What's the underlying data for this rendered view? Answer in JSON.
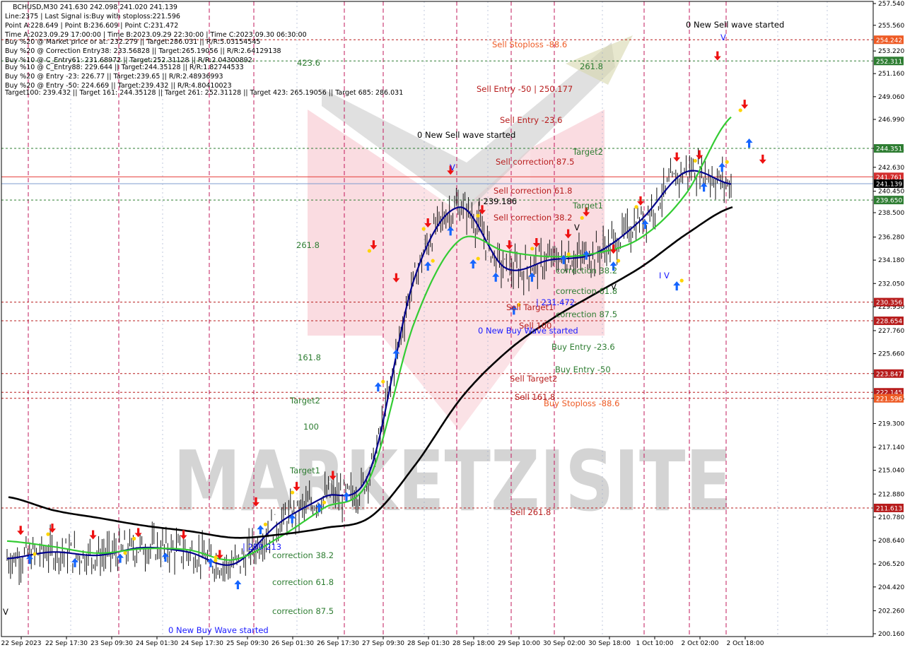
{
  "header": {
    "lines": [
      "BCHUSD,M30  241.630 242.098 241.020 241.139",
      "Line:2375  |  Last Signal is:Buy with stoploss:221.596",
      "Point A:228.649  |  Point B:236.609  |  Point C:231.472",
      "Time A:2023.09.29 17:00:00  |  Time B:2023.09.29 22:30:00  |  Time C:2023.09.30 06:30:00",
      "Buy %20 @ Market price or at: 232.279  ||  Target:286.031  ||  R/R:5.03154545",
      "Buy %20 @ Correction Entry38: 233.56828  ||  Target:265.19056  ||  R/R:2.64129138",
      "Buy %10 @ C_Entry61: 231.68972  ||  Target:252.31128  ||  R/R:2.04300892",
      "Buy %10 @ C_Entry88: 229.644  ||  Target:244.35128  ||  R/R:1.82744533",
      "Buy %20 @ Entry -23: 226.77  ||  Target:239.65  ||  R/R:2.48936993",
      "Buy %20 @ Entry -50: 224.669  ||  Target:239.432  ||  R/R:4.80410023",
      "Target100: 239.432  ||  Target 161: 244.35128  ||  Target 261: 252.31128  ||  Target 423: 265.19056  ||  Target 685: 286.031"
    ]
  },
  "colors": {
    "background": "#ffffff",
    "session_line": "#c2185b",
    "green_level": "#2e7d32",
    "red_level": "#b71c1c",
    "blue_line": "#00008b",
    "green_ma": "#33cc33",
    "black_ma": "#000000",
    "buy_arrow": "#1565ff",
    "sell_arrow": "#ee1111",
    "star": "#ffd400",
    "watermark": "#b8b8b8",
    "pink_arrow": "#f29ca8"
  },
  "watermark": {
    "text": "MARKETZISITE"
  },
  "price_axis": {
    "ticks": [
      "257.540",
      "255.560",
      "253.220",
      "251.160",
      "249.060",
      "246.990",
      "244.351",
      "242.630",
      "240.450",
      "238.500",
      "236.280",
      "234.180",
      "232.050",
      "229.930",
      "227.760",
      "225.660",
      "223.847",
      "221.596",
      "219.300",
      "217.140",
      "215.040",
      "212.880",
      "210.780",
      "208.640",
      "206.520",
      "204.420",
      "202.260",
      "200.160"
    ],
    "badges": [
      {
        "text": "254.242",
        "color": "#ee5a24"
      },
      {
        "text": "252.311",
        "color": "#2e7d32"
      },
      {
        "text": "244.351",
        "color": "#2e7d32"
      },
      {
        "text": "241.761",
        "color": "#d32f2f"
      },
      {
        "text": "241.139",
        "color": "#000000"
      },
      {
        "text": "239.650",
        "color": "#2e7d32"
      },
      {
        "text": "230.356",
        "color": "#b71c1c"
      },
      {
        "text": "228.654",
        "color": "#b71c1c"
      },
      {
        "text": "223.847",
        "color": "#b71c1c"
      },
      {
        "text": "222.145",
        "color": "#b71c1c"
      },
      {
        "text": "221.596",
        "color": "#ee5a24"
      },
      {
        "text": "211.613",
        "color": "#b71c1c"
      }
    ]
  },
  "time_axis": {
    "labels": [
      "22 Sep 2023",
      "22 Sep 17:30",
      "23 Sep 09:30",
      "24 Sep 01:30",
      "24 Sep 17:30",
      "25 Sep 09:30",
      "26 Sep 01:30",
      "26 Sep 17:30",
      "27 Sep 09:30",
      "28 Sep 01:30",
      "28 Sep 18:00",
      "29 Sep 10:00",
      "30 Sep 02:00",
      "30 Sep 18:00",
      "1 Oct 10:00",
      "2 Oct 02:00",
      "2 Oct 18:00"
    ]
  },
  "annotations": {
    "sell_stoploss": "Sell Stoploss -88.6",
    "sell_entry_50": "Sell Entry -50 | 250.177",
    "sell_entry_23": "Sell Entry -23.6",
    "sell_corr_875": "Sell correction 87.5",
    "sell_corr_618": "Sell correction 61.8",
    "sell_corr_382": "Sell correction 38.2",
    "sell_target1": "Sell Target1",
    "sell_100": "Sell 100",
    "sell_target2": "Sell Target2",
    "sell_1618": "Sell 161.8",
    "sell_2618": "Sell  261.8",
    "buy_stoploss": "Buy Stoploss -88.6",
    "buy_entry_23": "Buy Entry -23.6",
    "buy_entry_50": "Buy Entry -50",
    "corr_382": "correction 38.2",
    "corr_618": "correction 61.8",
    "corr_875": "correction 87.5",
    "corr_382_b": "correction 38.2",
    "corr_618_b": "correction 61.8",
    "corr_875_b": "correction 87.5",
    "lvl_4236": "423.6",
    "lvl_2618": "261.8",
    "lvl_2618_b": "261.8",
    "lvl_1618": "161.8",
    "lvl_100": "100",
    "target2_left": "Target2",
    "target1_left": "Target1",
    "target2_mid": "Target2",
    "target1_mid": "Target1",
    "new_sell_1": "0 New Sell wave started",
    "new_sell_2": "0 New Sell wave started",
    "new_buy_1": "0 New Buy Wave started",
    "new_buy_2": "0 New Buy Wave started",
    "pivot_1": "| 239.186",
    "pivot_2": "| 231.472",
    "pivot_3": "| 209.213",
    "mark_v": "V",
    "mark_iv": "I V"
  },
  "chart_data": {
    "type": "line",
    "title": "BCHUSD,M30",
    "ylim": [
      200.16,
      257.54
    ],
    "x": [
      "22 Sep 2023",
      "22 Sep 17:30",
      "23 Sep 09:30",
      "24 Sep 01:30",
      "24 Sep 17:30",
      "25 Sep 09:30",
      "26 Sep 01:30",
      "26 Sep 17:30",
      "27 Sep 09:30",
      "28 Sep 01:30",
      "28 Sep 18:00",
      "29 Sep 10:00",
      "30 Sep 02:00",
      "30 Sep 18:00",
      "1 Oct 10:00",
      "2 Oct 02:00",
      "2 Oct 18:00"
    ],
    "series": [
      {
        "values": [
          207.0,
          207.6,
          207.3,
          208.0,
          207.6,
          206.5,
          210.2,
          212.6,
          214.8,
          232.5,
          239.0,
          233.5,
          234.2,
          234.8,
          237.8,
          242.2,
          241.1
        ]
      },
      {
        "values": [
          208.6,
          208.1,
          207.5,
          207.9,
          207.8,
          206.9,
          208.9,
          211.6,
          214.2,
          228.5,
          236.0,
          235.0,
          234.5,
          234.8,
          236.2,
          240.2,
          247.2
        ]
      },
      {
        "values": [
          212.6,
          211.4,
          210.7,
          210.0,
          209.5,
          208.9,
          209.2,
          209.8,
          210.8,
          215.6,
          221.6,
          225.8,
          228.8,
          231.2,
          233.6,
          236.6,
          239.0
        ]
      }
    ],
    "levels": [
      254.242,
      252.311,
      244.351,
      241.761,
      239.65,
      230.356,
      228.654,
      223.847,
      222.145,
      221.596,
      211.613
    ],
    "current_price": 241.139,
    "signal_arrows": {
      "buy": [
        [
          0.5,
          206.9
        ],
        [
          1.5,
          206.6
        ],
        [
          2.5,
          207.0
        ],
        [
          3.5,
          207.1
        ],
        [
          4.5,
          206.6
        ],
        [
          5.1,
          204.6
        ],
        [
          5.6,
          209.6
        ],
        [
          6.3,
          210.6
        ],
        [
          6.9,
          211.6
        ],
        [
          7.5,
          212.6
        ],
        [
          8.2,
          222.6
        ],
        [
          8.6,
          225.6
        ],
        [
          9.3,
          233.6
        ],
        [
          9.8,
          236.8
        ],
        [
          10.3,
          233.8
        ],
        [
          10.8,
          232.6
        ],
        [
          11.2,
          229.6
        ],
        [
          11.6,
          232.6
        ],
        [
          12.3,
          234.2
        ],
        [
          12.8,
          234.6
        ],
        [
          13.4,
          233.6
        ],
        [
          14.1,
          237.4
        ],
        [
          14.8,
          231.8
        ],
        [
          15.4,
          240.8
        ],
        [
          15.8,
          242.6
        ],
        [
          16.4,
          244.8
        ]
      ],
      "sell": [
        [
          0.3,
          209.6
        ],
        [
          1.0,
          209.8
        ],
        [
          1.9,
          209.2
        ],
        [
          2.9,
          209.4
        ],
        [
          3.9,
          209.2
        ],
        [
          4.7,
          207.4
        ],
        [
          5.5,
          212.2
        ],
        [
          6.4,
          213.6
        ],
        [
          7.2,
          214.6
        ],
        [
          8.1,
          235.6
        ],
        [
          8.6,
          232.6
        ],
        [
          9.3,
          237.6
        ],
        [
          9.8,
          242.4
        ],
        [
          10.5,
          238.8
        ],
        [
          11.1,
          235.6
        ],
        [
          11.7,
          235.8
        ],
        [
          12.4,
          236.6
        ],
        [
          12.8,
          238.6
        ],
        [
          13.4,
          235.2
        ],
        [
          14.0,
          239.6
        ],
        [
          14.8,
          243.6
        ],
        [
          15.3,
          243.8
        ],
        [
          15.7,
          252.8
        ],
        [
          16.3,
          248.4
        ],
        [
          16.7,
          243.4
        ]
      ]
    }
  }
}
